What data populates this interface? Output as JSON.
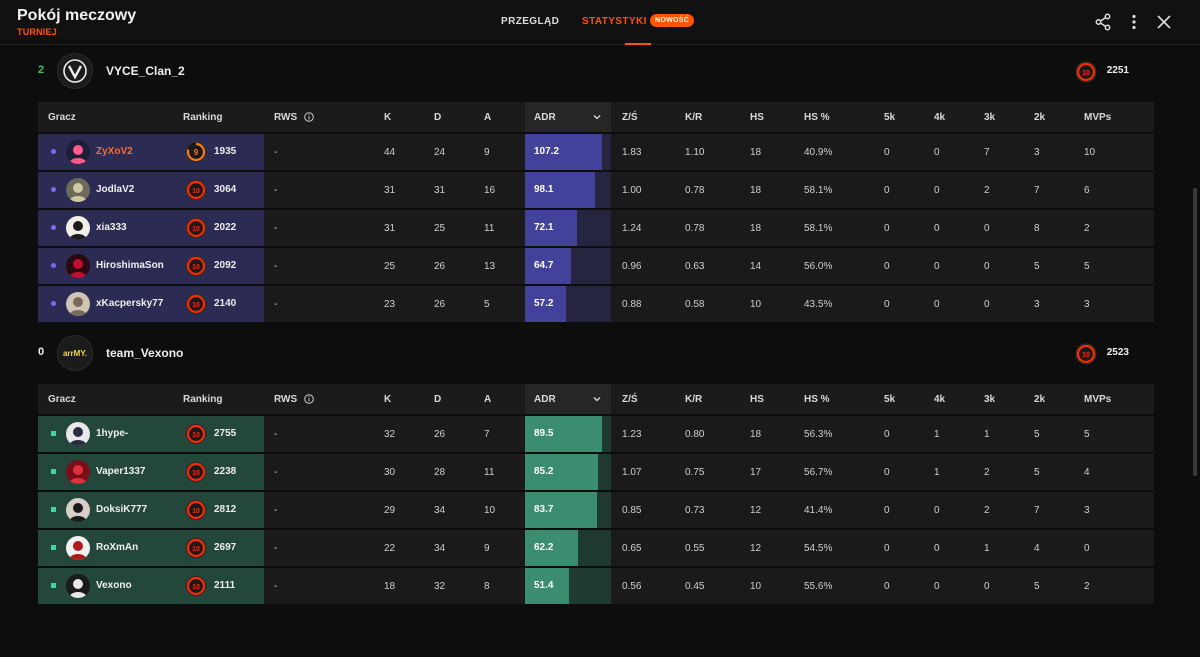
{
  "header": {
    "title": "Pokój meczowy",
    "subtitle": "TURNIEJ",
    "tabs": [
      "PRZEGLĄD",
      "STATYSTYKI"
    ],
    "new_badge": "NOWOŚĆ"
  },
  "columns": [
    "Gracz",
    "Ranking",
    "RWS",
    "K",
    "D",
    "A",
    "ADR",
    "Z/Ś",
    "K/R",
    "HS",
    "HS %",
    "5k",
    "4k",
    "3k",
    "2k",
    "MVPs"
  ],
  "teams": [
    {
      "score": "2",
      "score_color": "#3cc55c",
      "name": "VYCE_Clan_2",
      "level": "10",
      "elo": "2251",
      "adr_max": 120,
      "players": [
        {
          "name": "ZyXoV2",
          "level": "9",
          "elo": "1935",
          "rws": "-",
          "k": "44",
          "d": "24",
          "a": "9",
          "adr": "107.2",
          "kd": "1.83",
          "kr": "1.10",
          "hs": "18",
          "hsp": "40.9%",
          "k5": "0",
          "k4": "0",
          "k3": "7",
          "k2": "3",
          "mvp": "10"
        },
        {
          "name": "JodlaV2",
          "level": "10",
          "elo": "3064",
          "rws": "-",
          "k": "31",
          "d": "31",
          "a": "16",
          "adr": "98.1",
          "kd": "1.00",
          "kr": "0.78",
          "hs": "18",
          "hsp": "58.1%",
          "k5": "0",
          "k4": "0",
          "k3": "2",
          "k2": "7",
          "mvp": "6"
        },
        {
          "name": "xia333",
          "level": "10",
          "elo": "2022",
          "rws": "-",
          "k": "31",
          "d": "25",
          "a": "11",
          "adr": "72.1",
          "kd": "1.24",
          "kr": "0.78",
          "hs": "18",
          "hsp": "58.1%",
          "k5": "0",
          "k4": "0",
          "k3": "0",
          "k2": "8",
          "mvp": "2"
        },
        {
          "name": "HiroshimaSon",
          "level": "10",
          "elo": "2092",
          "rws": "-",
          "k": "25",
          "d": "26",
          "a": "13",
          "adr": "64.7",
          "kd": "0.96",
          "kr": "0.63",
          "hs": "14",
          "hsp": "56.0%",
          "k5": "0",
          "k4": "0",
          "k3": "0",
          "k2": "5",
          "mvp": "5"
        },
        {
          "name": "xKacpersky77",
          "level": "10",
          "elo": "2140",
          "rws": "-",
          "k": "23",
          "d": "26",
          "a": "5",
          "adr": "57.2",
          "kd": "0.88",
          "kr": "0.58",
          "hs": "10",
          "hsp": "43.5%",
          "k5": "0",
          "k4": "0",
          "k3": "0",
          "k2": "3",
          "mvp": "3"
        }
      ]
    },
    {
      "score": "0",
      "score_color": "#eeeeee",
      "name": "team_Vexono",
      "level": "10",
      "elo": "2523",
      "adr_max": 100,
      "players": [
        {
          "name": "1hype-",
          "level": "10",
          "elo": "2755",
          "rws": "-",
          "k": "32",
          "d": "26",
          "a": "7",
          "adr": "89.5",
          "kd": "1.23",
          "kr": "0.80",
          "hs": "18",
          "hsp": "56.3%",
          "k5": "0",
          "k4": "1",
          "k3": "1",
          "k2": "5",
          "mvp": "5"
        },
        {
          "name": "Vaper1337",
          "level": "10",
          "elo": "2238",
          "rws": "-",
          "k": "30",
          "d": "28",
          "a": "11",
          "adr": "85.2",
          "kd": "1.07",
          "kr": "0.75",
          "hs": "17",
          "hsp": "56.7%",
          "k5": "0",
          "k4": "1",
          "k3": "2",
          "k2": "5",
          "mvp": "4"
        },
        {
          "name": "DoksiK777",
          "level": "10",
          "elo": "2812",
          "rws": "-",
          "k": "29",
          "d": "34",
          "a": "10",
          "adr": "83.7",
          "kd": "0.85",
          "kr": "0.73",
          "hs": "12",
          "hsp": "41.4%",
          "k5": "0",
          "k4": "0",
          "k3": "2",
          "k2": "7",
          "mvp": "3"
        },
        {
          "name": "RoXmAn",
          "level": "10",
          "elo": "2697",
          "rws": "-",
          "k": "22",
          "d": "34",
          "a": "9",
          "adr": "62.2",
          "kd": "0.65",
          "kr": "0.55",
          "hs": "12",
          "hsp": "54.5%",
          "k5": "0",
          "k4": "0",
          "k3": "1",
          "k2": "4",
          "mvp": "0"
        },
        {
          "name": "Vexono",
          "level": "10",
          "elo": "2111",
          "rws": "-",
          "k": "18",
          "d": "32",
          "a": "8",
          "adr": "51.4",
          "kd": "0.56",
          "kr": "0.45",
          "hs": "10",
          "hsp": "55.6%",
          "k5": "0",
          "k4": "0",
          "k3": "0",
          "k2": "5",
          "mvp": "2"
        }
      ]
    }
  ],
  "team_logos": [
    "VYCE",
    "arrMY."
  ],
  "colors": {
    "accent": "#ff5500",
    "team1": "#2b2b53",
    "team2": "#23483b"
  }
}
